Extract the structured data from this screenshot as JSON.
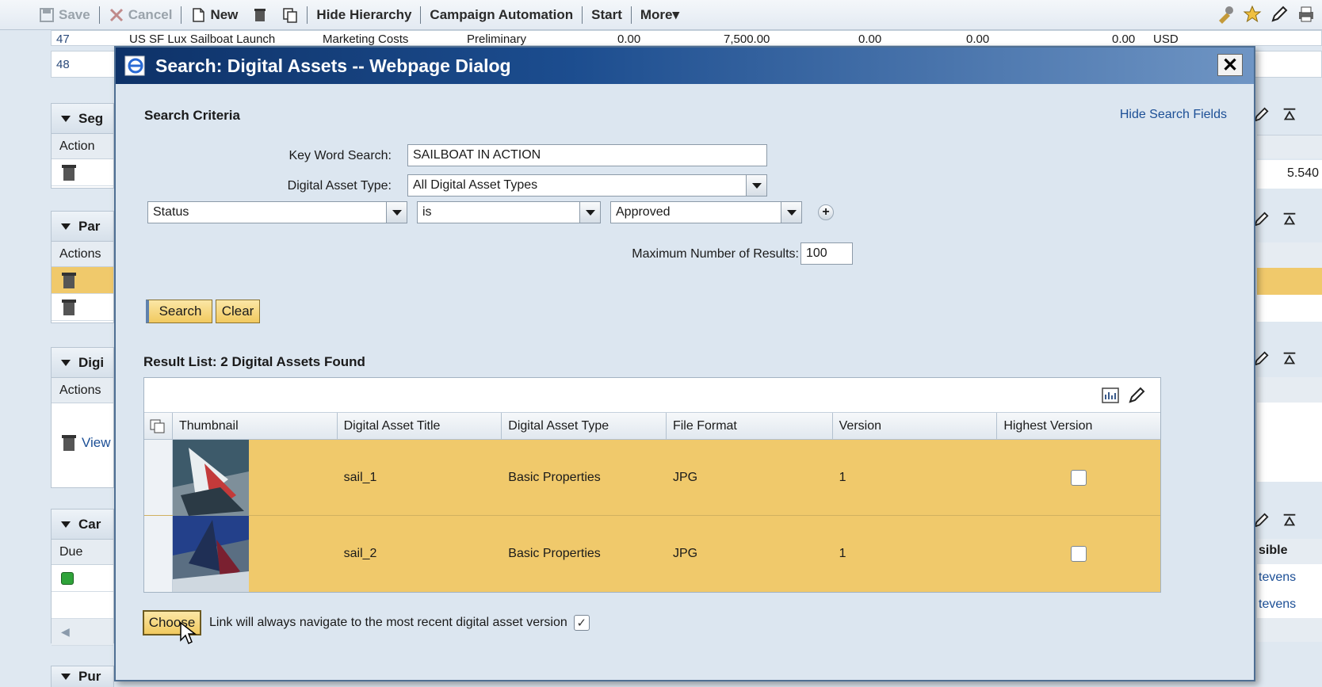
{
  "toolbar": {
    "save": "Save",
    "cancel": "Cancel",
    "new": "New",
    "hide_hierarchy": "Hide Hierarchy",
    "campaign_automation": "Campaign Automation",
    "start": "Start",
    "more": "More▾"
  },
  "background": {
    "row47": {
      "num": "47",
      "name": "US SF Lux Sailboat Launch",
      "type": "Marketing Costs",
      "status": "Preliminary",
      "v1": "0.00",
      "v2": "7,500.00",
      "v3": "0.00",
      "v4": "0.00",
      "v5": "0.00",
      "cur": "USD"
    },
    "row48": {
      "num": "48"
    },
    "panels": [
      {
        "title": "Seg",
        "sub": "Action"
      },
      {
        "title": "Par",
        "sub": "Actions"
      },
      {
        "title": "Digi",
        "sub": "Actions",
        "link": "View"
      },
      {
        "title": "Car",
        "sub": "Due"
      },
      {
        "title": "Pur"
      }
    ],
    "right_value": "5.540",
    "right_header": "sible",
    "right_name1": "tevens",
    "right_name2": "tevens"
  },
  "dialog": {
    "title": "Search: Digital Assets -- Webpage Dialog",
    "close": "✕",
    "search_criteria": "Search Criteria",
    "hide_search_fields": "Hide Search Fields",
    "keyword_label": "Key Word Search:",
    "keyword_value": "SAILBOAT IN ACTION",
    "asset_type_label": "Digital Asset Type:",
    "asset_type_value": "All Digital Asset Types",
    "filter_field": "Status",
    "filter_operator": "is",
    "filter_value": "Approved",
    "max_results_label": "Maximum Number of Results:",
    "max_results_value": "100",
    "search_button": "Search",
    "clear_button": "Clear",
    "result_title": "Result List: 2 Digital Assets Found",
    "columns": [
      "Thumbnail",
      "Digital Asset Title",
      "Digital Asset Type",
      "File Format",
      "Version",
      "Highest Version"
    ],
    "rows": [
      {
        "title": "sail_1",
        "type": "Basic Properties",
        "format": "JPG",
        "version": "1",
        "highest": false
      },
      {
        "title": "sail_2",
        "type": "Basic Properties",
        "format": "JPG",
        "version": "1",
        "highest": false
      }
    ],
    "choose_button": "Choose",
    "link_text": "Link will always navigate to the most recent digital asset version",
    "link_checked": "✓"
  }
}
